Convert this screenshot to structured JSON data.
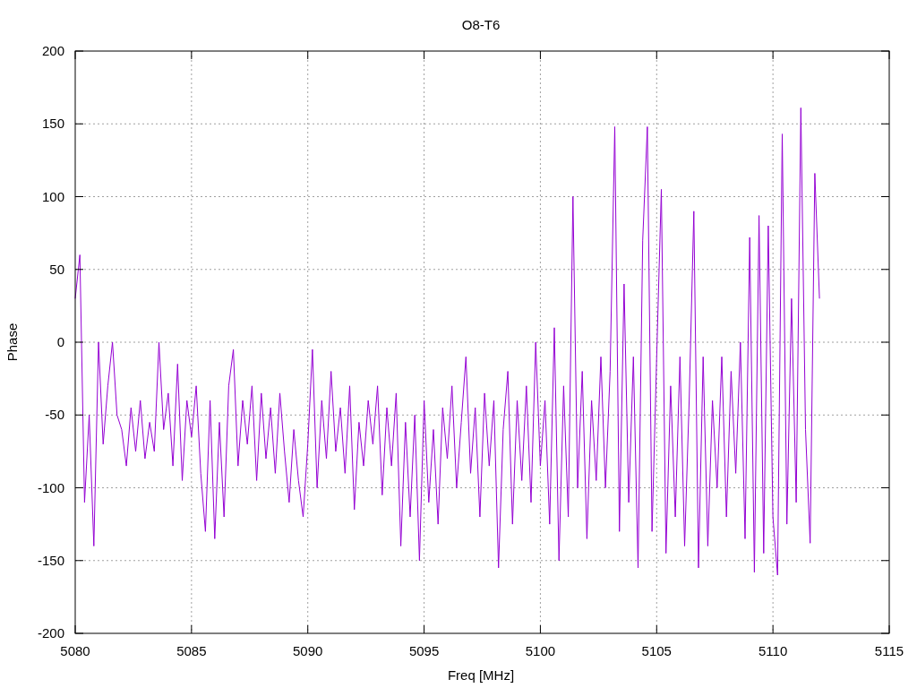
{
  "plot": {
    "chart_data": {
      "type": "line",
      "title": "O8-T6",
      "xlabel": "Freq [MHz]",
      "ylabel": "Phase",
      "grid": true,
      "xlim": [
        5080,
        5115
      ],
      "ylim": [
        -200,
        200
      ],
      "xticks": [
        5080,
        5085,
        5090,
        5095,
        5100,
        5105,
        5110,
        5115
      ],
      "yticks": [
        200,
        150,
        100,
        50,
        0,
        -50,
        -100,
        -150,
        -200
      ],
      "x": [
        5080,
        5080.2,
        5080.4,
        5080.6,
        5080.8,
        5081,
        5081.2,
        5081.4,
        5081.6,
        5081.8,
        5082,
        5082.2,
        5082.4,
        5082.6,
        5082.8,
        5083,
        5083.2,
        5083.4,
        5083.6,
        5083.8,
        5084,
        5084.2,
        5084.4,
        5084.6,
        5084.8,
        5085,
        5085.2,
        5085.4,
        5085.6,
        5085.8,
        5086,
        5086.2,
        5086.4,
        5086.6,
        5086.8,
        5087,
        5087.2,
        5087.4,
        5087.6,
        5087.8,
        5088,
        5088.2,
        5088.4,
        5088.6,
        5088.8,
        5089,
        5089.2,
        5089.4,
        5089.6,
        5089.8,
        5090,
        5090.2,
        5090.4,
        5090.6,
        5090.8,
        5091,
        5091.2,
        5091.4,
        5091.6,
        5091.8,
        5092,
        5092.2,
        5092.4,
        5092.6,
        5092.8,
        5093,
        5093.2,
        5093.4,
        5093.6,
        5093.8,
        5094,
        5094.2,
        5094.4,
        5094.6,
        5094.8,
        5095,
        5095.2,
        5095.4,
        5095.6,
        5095.8,
        5096,
        5096.2,
        5096.4,
        5096.6,
        5096.8,
        5097,
        5097.2,
        5097.4,
        5097.6,
        5097.8,
        5098,
        5098.2,
        5098.4,
        5098.6,
        5098.8,
        5099,
        5099.2,
        5099.4,
        5099.6,
        5099.8,
        5100,
        5100.2,
        5100.4,
        5100.6,
        5100.8,
        5101,
        5101.2,
        5101.4,
        5101.6,
        5101.8,
        5102,
        5102.2,
        5102.4,
        5102.6,
        5102.8,
        5103,
        5103.2,
        5103.4,
        5103.6,
        5103.8,
        5104,
        5104.2,
        5104.4,
        5104.6,
        5104.8,
        5105,
        5105.2,
        5105.4,
        5105.6,
        5105.8,
        5106,
        5106.2,
        5106.4,
        5106.6,
        5106.8,
        5107,
        5107.2,
        5107.4,
        5107.6,
        5107.8,
        5108,
        5108.2,
        5108.4,
        5108.6,
        5108.8,
        5109,
        5109.2,
        5109.4,
        5109.6,
        5109.8,
        5110,
        5110.2,
        5110.4,
        5110.6,
        5110.8,
        5111,
        5111.2,
        5111.4,
        5111.6,
        5111.8,
        5112
      ],
      "series": [
        {
          "color": "#9400d3",
          "values": [
            30,
            60,
            -110,
            -50,
            -140,
            0,
            -70,
            -30,
            0,
            -50,
            -60,
            -85,
            -45,
            -75,
            -40,
            -80,
            -55,
            -75,
            0,
            -60,
            -35,
            -85,
            -15,
            -95,
            -40,
            -65,
            -30,
            -90,
            -130,
            -40,
            -135,
            -55,
            -120,
            -30,
            -5,
            -85,
            -40,
            -70,
            -30,
            -95,
            -35,
            -80,
            -45,
            -90,
            -35,
            -75,
            -110,
            -60,
            -95,
            -120,
            -70,
            -5,
            -100,
            -40,
            -80,
            -20,
            -75,
            -45,
            -90,
            -30,
            -115,
            -55,
            -85,
            -40,
            -70,
            -30,
            -105,
            -45,
            -85,
            -35,
            -140,
            -55,
            -120,
            -50,
            -150,
            -40,
            -110,
            -60,
            -125,
            -45,
            -80,
            -30,
            -100,
            -55,
            -10,
            -90,
            -45,
            -120,
            -35,
            -85,
            -40,
            -155,
            -60,
            -20,
            -125,
            -40,
            -95,
            -30,
            -110,
            0,
            -85,
            -40,
            -125,
            10,
            -150,
            -30,
            -120,
            100,
            -100,
            -20,
            -135,
            -40,
            -95,
            -10,
            -100,
            -20,
            148,
            -130,
            40,
            -110,
            -10,
            -155,
            70,
            148,
            -130,
            -10,
            105,
            -145,
            -30,
            -120,
            -10,
            -140,
            -40,
            90,
            -155,
            -10,
            -140,
            -40,
            -100,
            -10,
            -120,
            -20,
            -90,
            0,
            -135,
            72,
            -158,
            87,
            -145,
            80,
            -120,
            -160,
            143,
            -125,
            30,
            -110,
            161,
            -60,
            -138,
            116,
            30
          ]
        }
      ]
    }
  }
}
